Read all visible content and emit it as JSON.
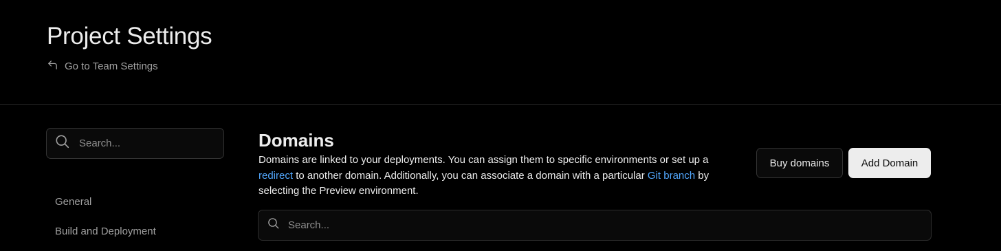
{
  "header": {
    "title": "Project Settings",
    "back_link": "Go to Team Settings",
    "back_icon": "arrow-back-icon"
  },
  "sidebar": {
    "search": {
      "placeholder": "Search..."
    },
    "items": [
      {
        "label": "General"
      },
      {
        "label": "Build and Deployment"
      }
    ]
  },
  "main": {
    "title": "Domains",
    "description": {
      "part1": "Domains are linked to your deployments. You can assign them to specific environments or set up a ",
      "link1": "redirect",
      "part2": " to another domain. Additionally, you can associate a domain with a particular ",
      "link2": "Git branch",
      "part3": " by selecting the Preview environment."
    },
    "buttons": {
      "buy": "Buy domains",
      "add": "Add Domain"
    },
    "search": {
      "placeholder": "Search..."
    }
  },
  "colors": {
    "background": "#000000",
    "link": "#52a8ff",
    "primary_button_bg": "#ededed",
    "border": "#333333"
  }
}
